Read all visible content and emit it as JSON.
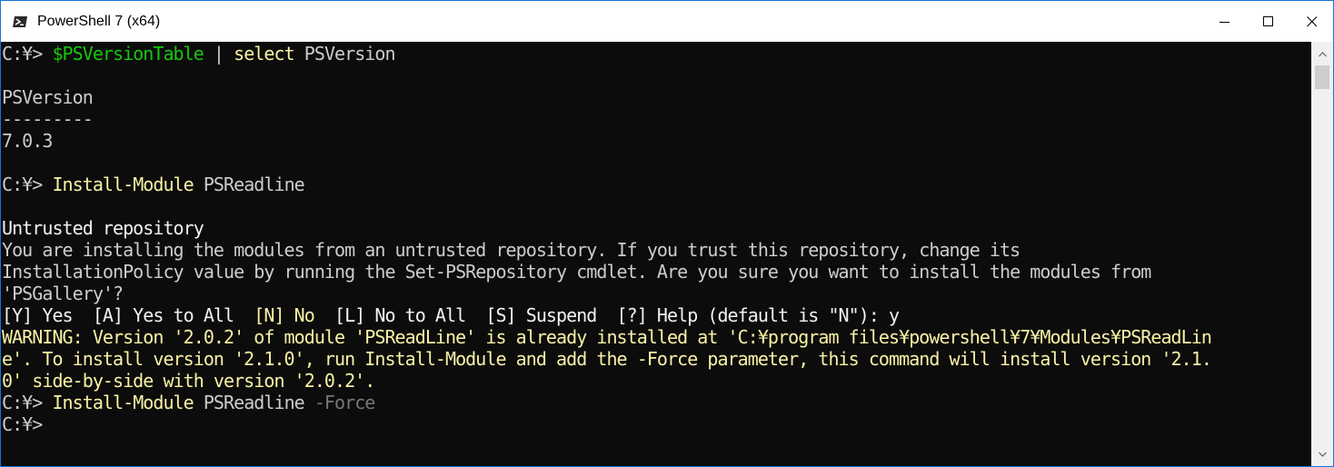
{
  "window": {
    "title": "PowerShell 7 (x64)",
    "accent_color": "#1874d8",
    "caption_buttons": [
      "minimize-icon",
      "maximize-icon",
      "close-icon"
    ]
  },
  "console": {
    "background": "#0c0c0c",
    "lines": [
      {
        "segments": [
          {
            "text": "C:¥> ",
            "color": "white"
          },
          {
            "text": "$PSVersionTable",
            "color": "green"
          },
          {
            "text": " | ",
            "color": "white"
          },
          {
            "text": "select",
            "color": "yellow"
          },
          {
            "text": " PSVersion",
            "color": "white"
          }
        ]
      },
      {
        "segments": []
      },
      {
        "segments": [
          {
            "text": "PSVersion",
            "color": "white"
          }
        ]
      },
      {
        "segments": [
          {
            "text": "---------",
            "color": "white"
          }
        ]
      },
      {
        "segments": [
          {
            "text": "7.0.3",
            "color": "white"
          }
        ]
      },
      {
        "segments": []
      },
      {
        "segments": [
          {
            "text": "C:¥> ",
            "color": "white"
          },
          {
            "text": "Install-Module",
            "color": "yellow"
          },
          {
            "text": " PSReadline",
            "color": "white"
          }
        ]
      },
      {
        "segments": []
      },
      {
        "segments": [
          {
            "text": "Untrusted repository",
            "color": "bright"
          }
        ]
      },
      {
        "segments": [
          {
            "text": "You are installing the modules from an untrusted repository. If you trust this repository, change its",
            "color": "white"
          }
        ]
      },
      {
        "segments": [
          {
            "text": "InstallationPolicy value by running the Set-PSRepository cmdlet. Are you sure you want to install the modules from",
            "color": "white"
          }
        ]
      },
      {
        "segments": [
          {
            "text": "'PSGallery'?",
            "color": "white"
          }
        ]
      },
      {
        "segments": [
          {
            "text": "[Y] Yes  [A] Yes to All  ",
            "color": "bright"
          },
          {
            "text": "[N] No",
            "color": "yellow"
          },
          {
            "text": "  [L] No to All  [S] Suspend  [?] Help (default is \"N\"): y",
            "color": "bright"
          }
        ]
      },
      {
        "segments": [
          {
            "text": "WARNING: Version '2.0.2' of module 'PSReadLine' is already installed at 'C:¥program files¥powershell¥7¥Modules¥PSReadLin",
            "color": "warn"
          }
        ]
      },
      {
        "segments": [
          {
            "text": "e'. To install version '2.1.0', run Install-Module and add the -Force parameter, this command will install version '2.1.",
            "color": "warn"
          }
        ]
      },
      {
        "segments": [
          {
            "text": "0' side-by-side with version '2.0.2'.",
            "color": "warn"
          }
        ]
      },
      {
        "segments": [
          {
            "text": "C:¥> ",
            "color": "white"
          },
          {
            "text": "Install-Module",
            "color": "yellow"
          },
          {
            "text": " PSReadline ",
            "color": "white"
          },
          {
            "text": "-Force",
            "color": "gray"
          }
        ]
      },
      {
        "segments": [
          {
            "text": "C:¥>",
            "color": "white"
          }
        ]
      }
    ]
  },
  "scrollbar": {
    "up_icon": "scroll-up-arrow-icon",
    "down_icon": "scroll-down-arrow-icon"
  }
}
